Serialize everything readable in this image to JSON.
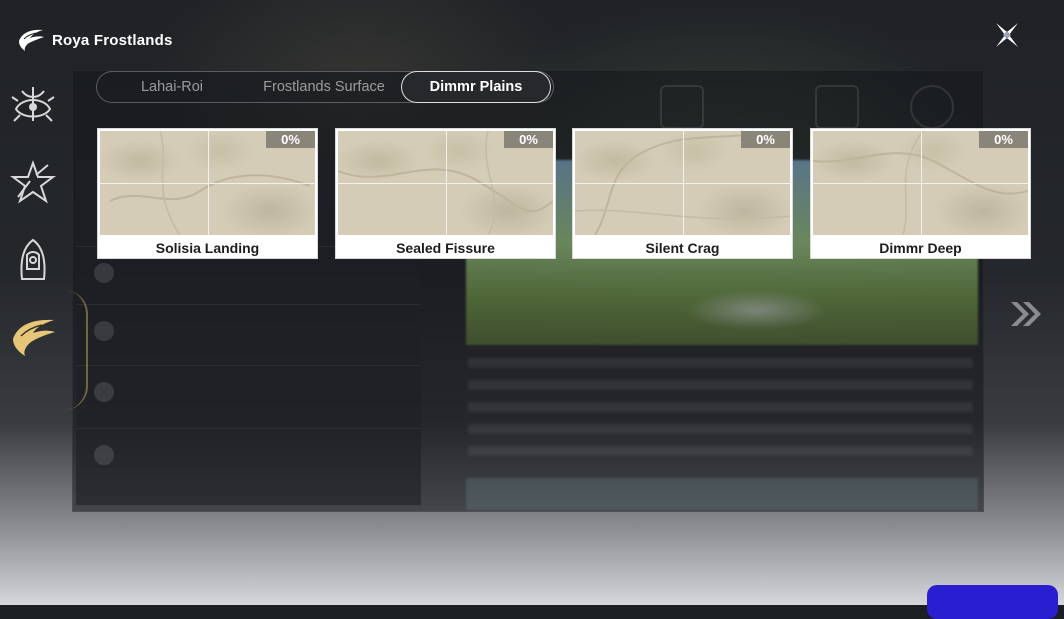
{
  "header": {
    "title": "Roya Frostlands",
    "logo_icon": "feather-crest-icon"
  },
  "close_icon": "close-x-icon",
  "sidebar": {
    "items": [
      {
        "icon": "serpent-emblem-icon"
      },
      {
        "icon": "star-emblem-icon"
      },
      {
        "icon": "hooded-figure-icon"
      },
      {
        "icon": "feather-crest-icon",
        "active": true
      }
    ]
  },
  "tabs": [
    {
      "label": "Lahai-Roi",
      "active": false
    },
    {
      "label": "Frostlands Surface",
      "active": false
    },
    {
      "label": "Dimmr Plains",
      "active": true
    }
  ],
  "areas": [
    {
      "name": "Solisia Landing",
      "progress": "0%"
    },
    {
      "name": "Sealed Fissure",
      "progress": "0%"
    },
    {
      "name": "Silent Crag",
      "progress": "0%"
    },
    {
      "name": "Dimmr Deep",
      "progress": "0%"
    }
  ],
  "next_icon": "double-chevron-right-icon",
  "colors": {
    "active_tab_border": "#ffffff",
    "badge": "#8a8579",
    "bottom_button": "#2a1fd0"
  }
}
